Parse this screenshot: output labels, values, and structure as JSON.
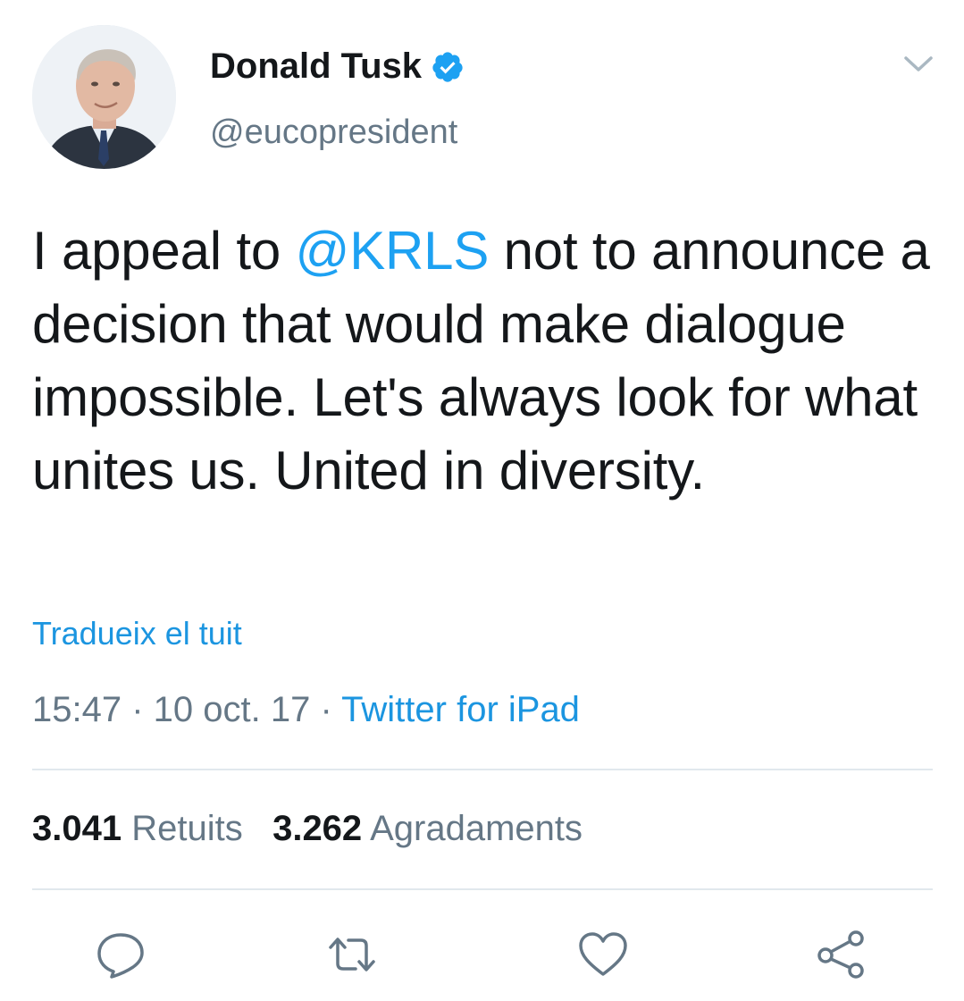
{
  "author": {
    "name": "Donald Tusk",
    "handle": "@eucopresident",
    "verified": true,
    "avatar_icon": "profile-photo"
  },
  "tweet": {
    "text_before_mention": "I appeal to ",
    "mention": "@KRLS",
    "text_after_mention": " not to announce a decision that would make dialogue impossible. Let's always look for what unites us. United in diversity."
  },
  "translate_label": "Tradueix el tuit",
  "meta": {
    "time": "15:47",
    "separator": " · ",
    "date": "10 oct. 17",
    "source": "Twitter for iPad"
  },
  "stats": {
    "retweets_count": "3.041",
    "retweets_label": "Retuits",
    "likes_count": "3.262",
    "likes_label": "Agradaments"
  },
  "actions": {
    "reply_icon": "reply-icon",
    "retweet_icon": "retweet-icon",
    "like_icon": "heart-icon",
    "share_icon": "share-icon"
  },
  "colors": {
    "accent": "#1da1f2",
    "link": "#1b95e0",
    "text": "#14171a",
    "muted": "#657786",
    "divider": "#e1e8ed"
  }
}
